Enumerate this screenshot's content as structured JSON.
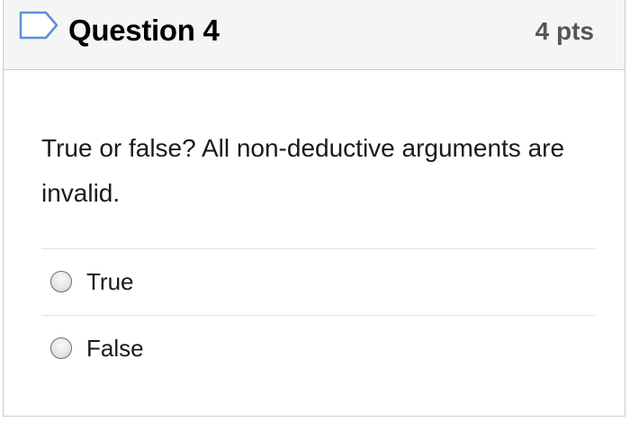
{
  "question": {
    "title": "Question 4",
    "points": "4 pts",
    "flag_icon": "flag-outline-icon",
    "text": "True or false? All non-deductive arguments are invalid."
  },
  "answers": [
    {
      "label": "True",
      "selected": false
    },
    {
      "label": "False",
      "selected": false
    }
  ],
  "colors": {
    "header_bg": "#f5f5f5",
    "border": "#c7cdd1",
    "flag_accent": "#5b8fd6"
  }
}
